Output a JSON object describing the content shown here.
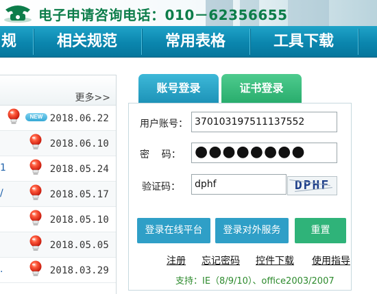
{
  "header": {
    "hotline": "电子申请咨询电话：010－62356655",
    "phone_icon": "telephone-icon"
  },
  "nav": {
    "items": [
      {
        "label": "规"
      },
      {
        "label": "相关规范"
      },
      {
        "label": "常用表格"
      },
      {
        "label": "工具下载"
      }
    ]
  },
  "news": {
    "more_label": "更多>>",
    "bulb_icon": "lightbulb-icon",
    "new_badge": "NEW",
    "rows": [
      {
        "fragment": "",
        "date": "2018.06.22",
        "is_new": true
      },
      {
        "fragment": "",
        "date": "2018.06.10"
      },
      {
        "fragment": "1",
        "date": "2018.05.24"
      },
      {
        "fragment": "/",
        "date": "2018.05.17"
      },
      {
        "fragment": "",
        "date": "2018.05.10"
      },
      {
        "fragment": "",
        "date": "2018.05.05"
      },
      {
        "fragment": ".",
        "date": "2018.03.29"
      }
    ]
  },
  "login": {
    "tabs": [
      {
        "label": "账号登录",
        "color": "#2a9fc4"
      },
      {
        "label": "证书登录",
        "color": "#38bb7c"
      }
    ],
    "account_label": "用户账号：",
    "account_value": "370103197511137552",
    "password_label": "密    码：",
    "password_value": "●●●●●●●●",
    "captcha_label": "验证码：",
    "captcha_value": "dphf",
    "captcha_image_text": "DPHF",
    "buttons": {
      "online": "登录在线平台",
      "external": "登录对外服务",
      "reset": "重置"
    },
    "links": [
      "注册",
      "忘记密码",
      "控件下载",
      "使用指导"
    ],
    "support": "支持：IE（8/9/10）、office2003/2007"
  },
  "colors": {
    "nav_blue": "#0b86ae",
    "tab_blue": "#2a9fc4",
    "tab_green": "#38bb7c",
    "hotline_green": "#0d7d4a",
    "support_green": "#2c8a2c"
  }
}
